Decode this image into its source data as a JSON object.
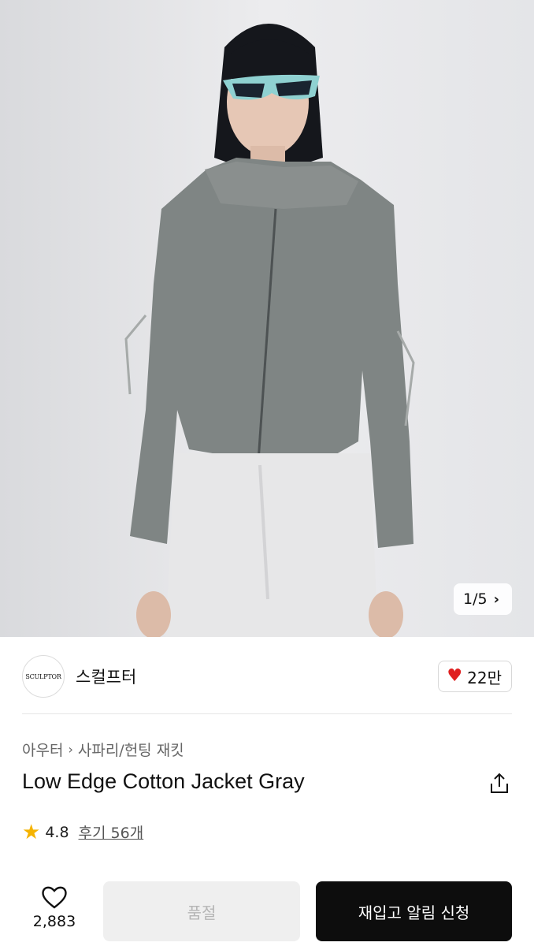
{
  "hero": {
    "pager_text": "1/5",
    "pager_icon": "chevron-right-icon"
  },
  "brand": {
    "logo_text": "SCULPTOR",
    "name": "스컬프터",
    "like_count": "22만",
    "like_icon": "heart-filled-icon",
    "like_color": "#e02020"
  },
  "product": {
    "category": "아우터",
    "subcategory": "사파리/헌팅 재킷",
    "title": "Low Edge Cotton Jacket Gray",
    "rating": "4.8",
    "reviews": "후기 56개",
    "star_color": "#f5b301"
  },
  "bottom_bar": {
    "wish_count": "2,883",
    "soldout_label": "품절",
    "restock_label": "재입고 알림 신청"
  }
}
